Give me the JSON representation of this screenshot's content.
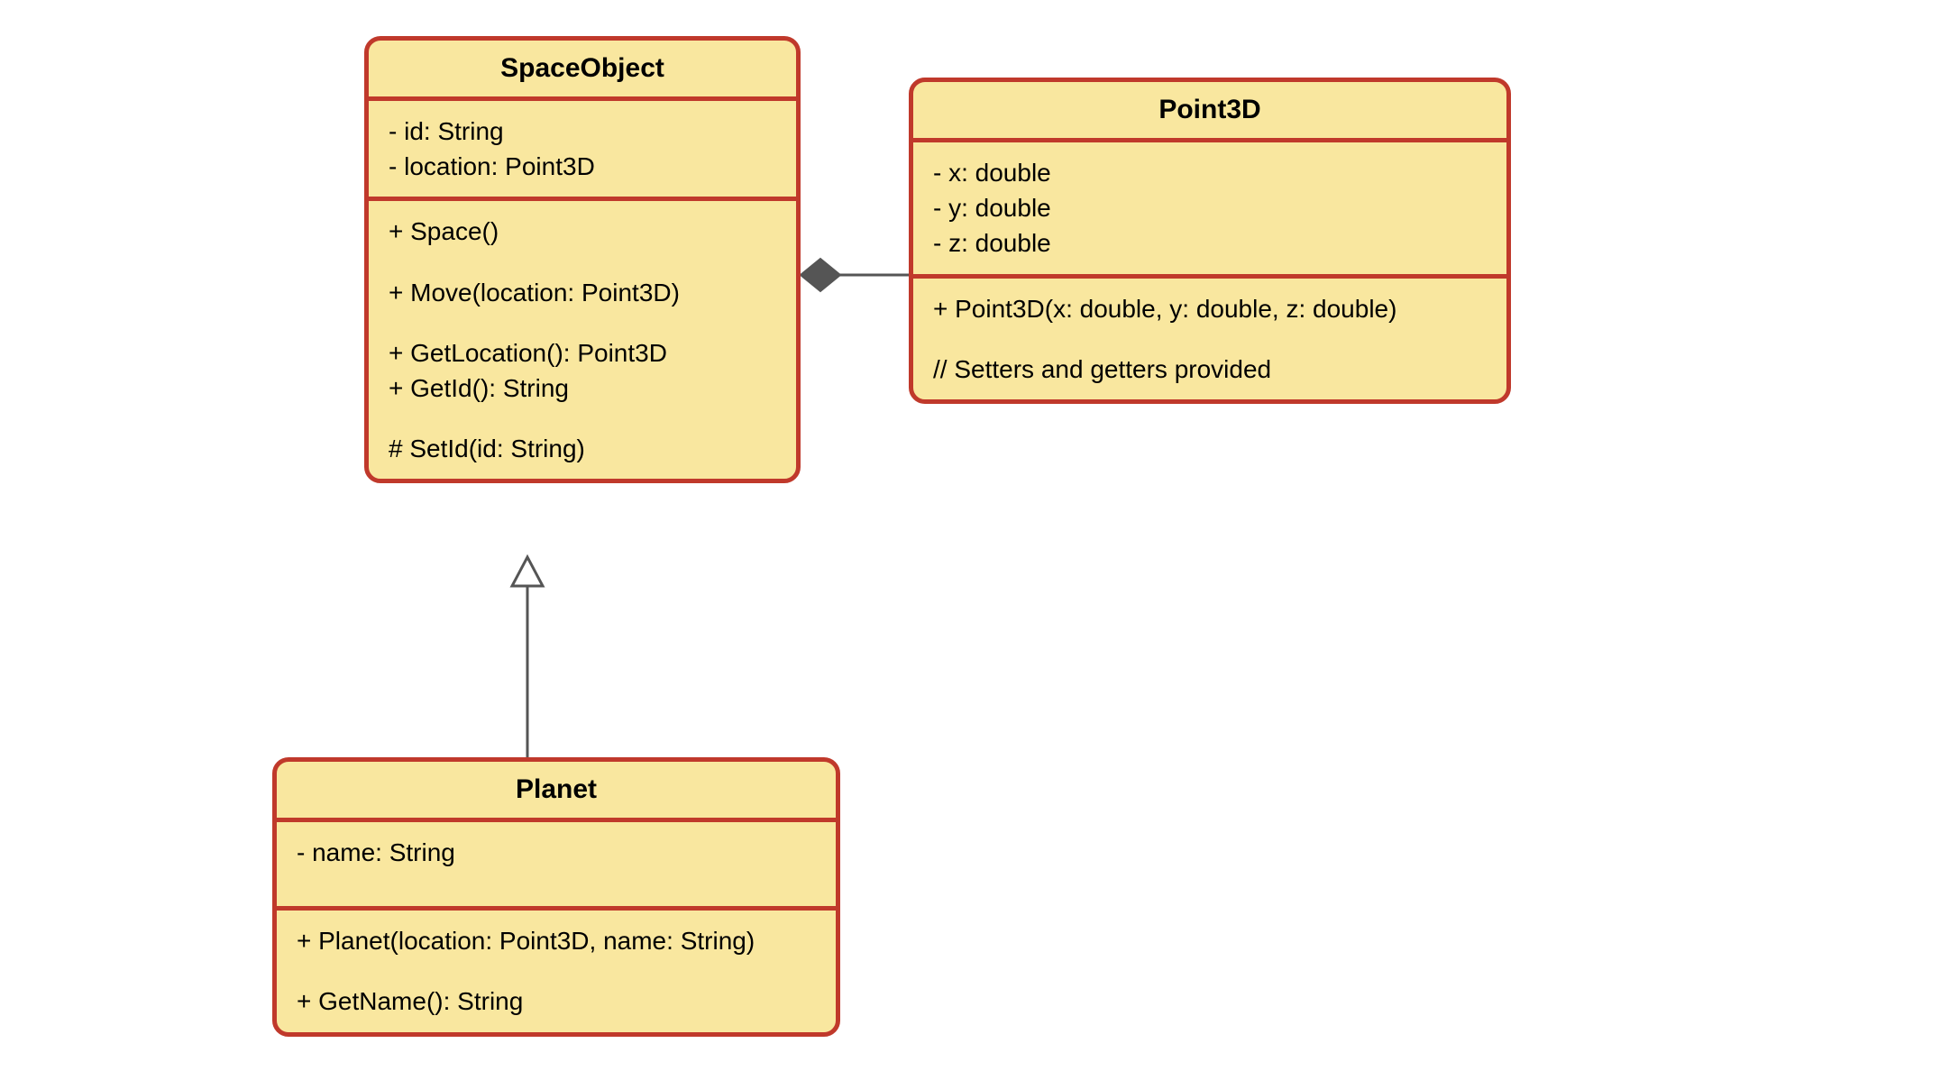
{
  "classes": {
    "spaceObject": {
      "name": "SpaceObject",
      "attributes": [
        "- id: String",
        "- location: Point3D"
      ],
      "operations": [
        "+ Space()",
        "",
        "+ Move(location: Point3D)",
        "",
        "+ GetLocation(): Point3D",
        "+ GetId(): String",
        "",
        "# SetId(id: String)"
      ]
    },
    "point3d": {
      "name": "Point3D",
      "attributes": [
        "- x: double",
        "- y: double",
        "- z: double"
      ],
      "operations": [
        "+ Point3D(x: double, y: double, z: double)",
        "",
        "// Setters and getters provided"
      ]
    },
    "planet": {
      "name": "Planet",
      "attributes": [
        "- name: String"
      ],
      "operations": [
        "+ Planet(location: Point3D, name: String)",
        "",
        "+ GetName(): String"
      ]
    }
  },
  "relationships": [
    {
      "from": "SpaceObject",
      "to": "Point3D",
      "type": "composition"
    },
    {
      "from": "Planet",
      "to": "SpaceObject",
      "type": "inheritance"
    }
  ]
}
